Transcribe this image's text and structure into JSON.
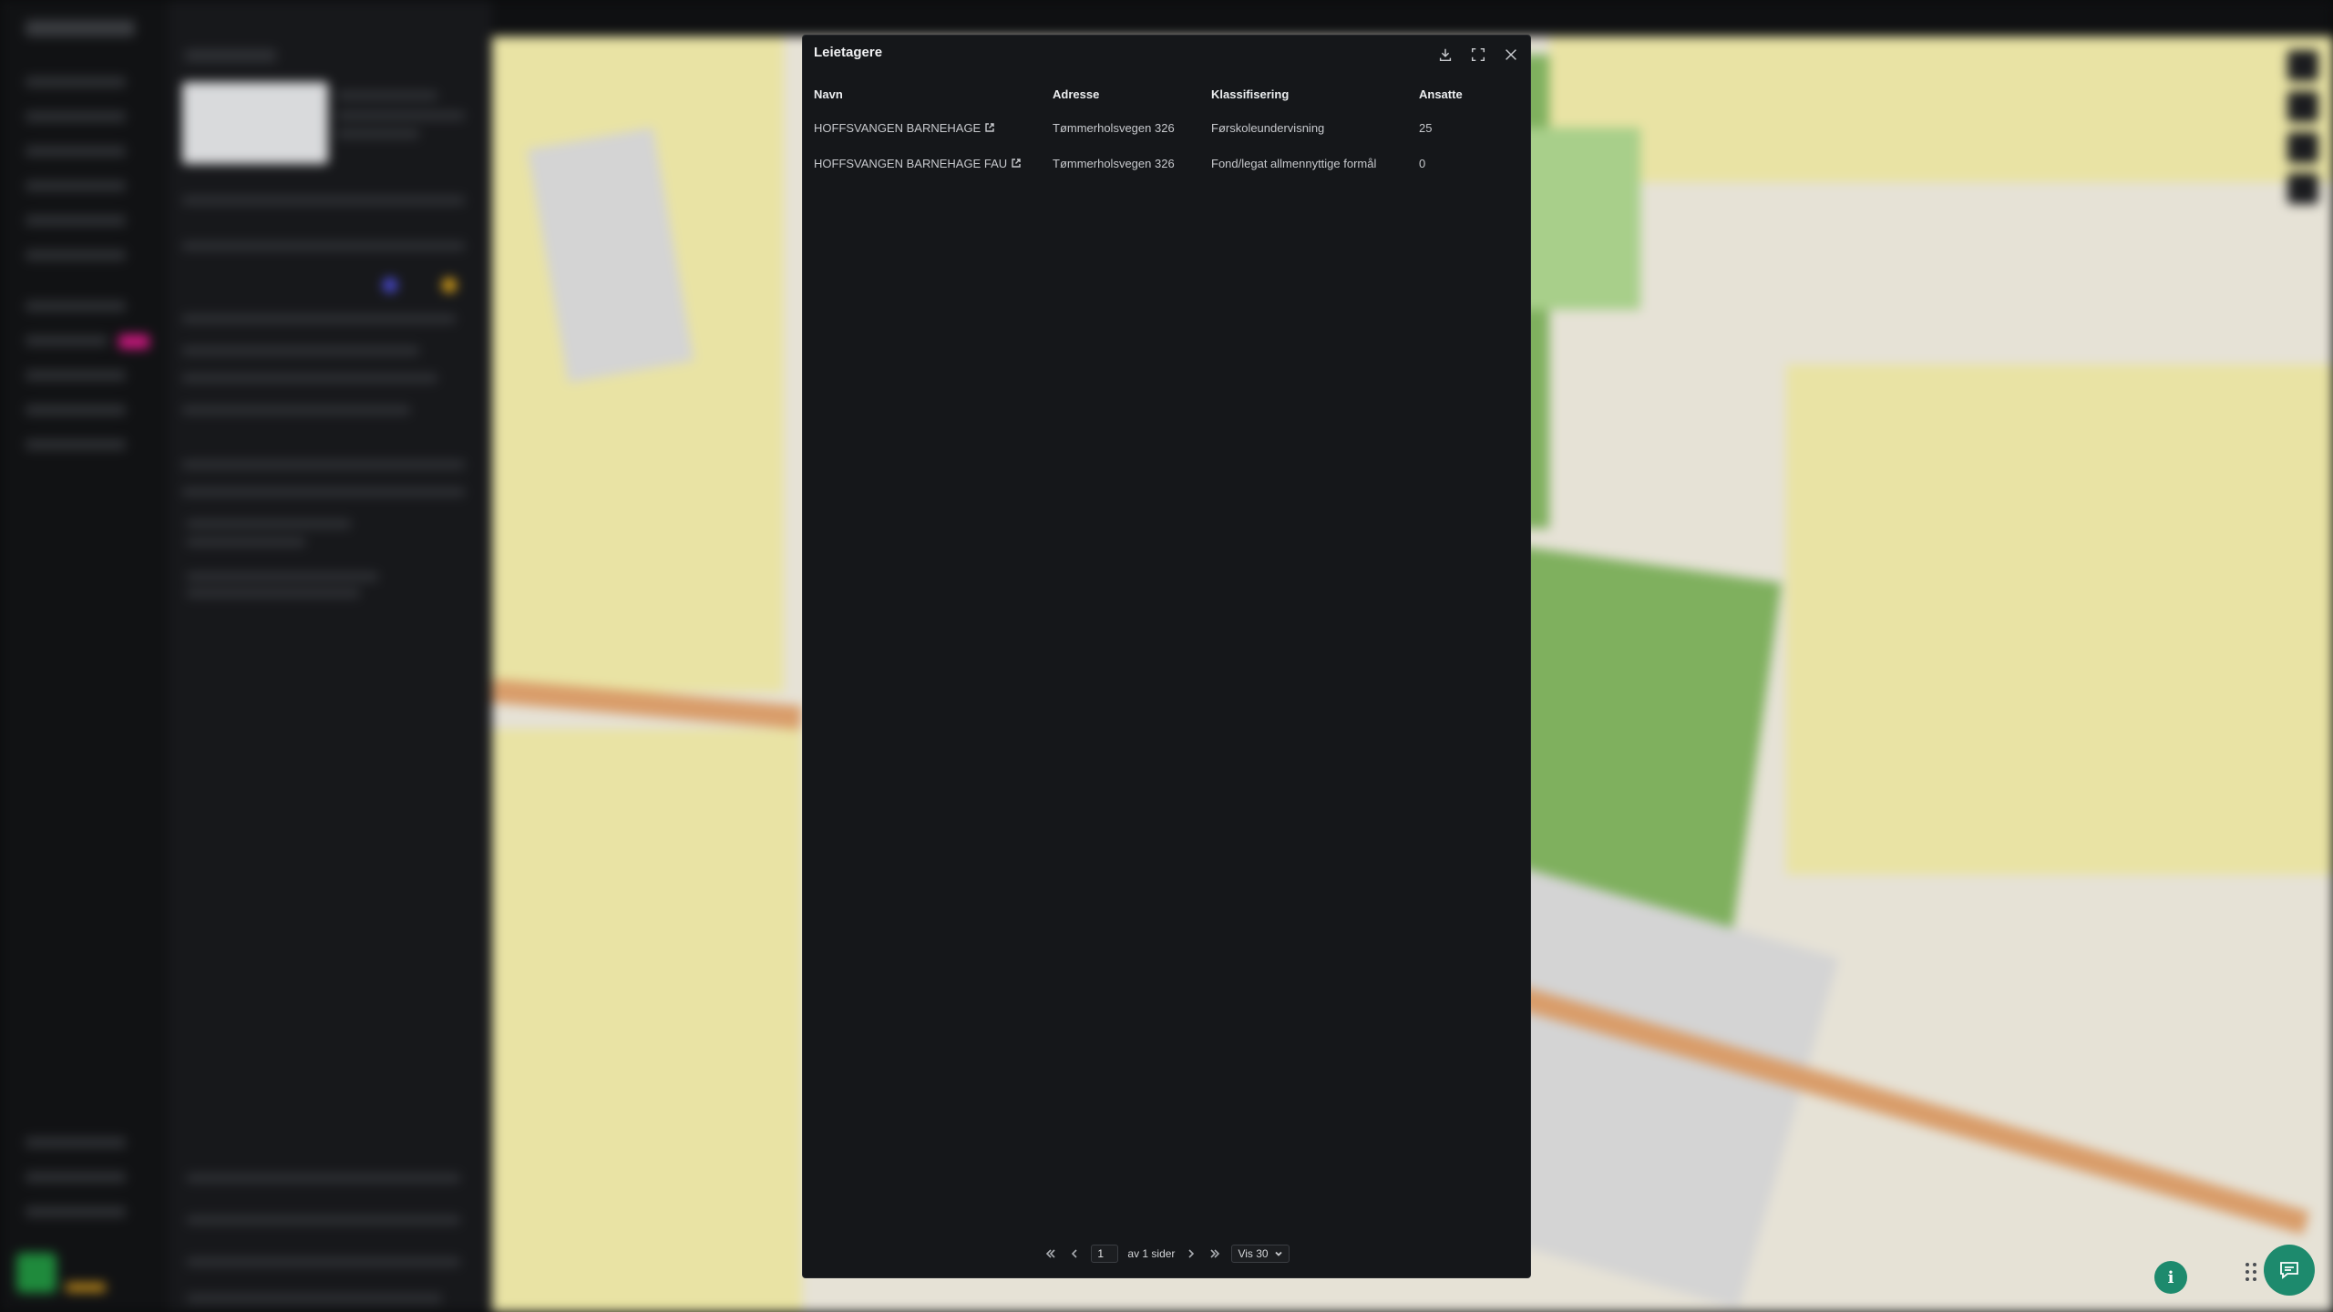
{
  "modal": {
    "title": "Leietagere",
    "columns": {
      "name": "Navn",
      "address": "Adresse",
      "classification": "Klassifisering",
      "employees": "Ansatte"
    },
    "rows": [
      {
        "name": "HOFFSVANGEN BARNEHAGE",
        "address": "Tømmerholsvegen 326",
        "classification": "Førskoleundervisning",
        "employees": "25"
      },
      {
        "name": "HOFFSVANGEN BARNEHAGE FAU",
        "address": "Tømmerholsvegen 326",
        "classification": "Fond/legat allmennyttige formål",
        "employees": "0"
      }
    ],
    "pagination": {
      "current_page": "1",
      "of_pages_text": "av 1 sider",
      "page_size_label": "Vis 30"
    }
  },
  "icons": {
    "download": "download-icon",
    "fullscreen": "fullscreen-icon",
    "close": "close-icon",
    "external": "external-link-icon",
    "info": "info-icon",
    "chat": "chat-icon"
  },
  "info_fab_label": "i",
  "colors": {
    "modal_bg": "#15171a",
    "accent_green": "#1d8a6d"
  }
}
